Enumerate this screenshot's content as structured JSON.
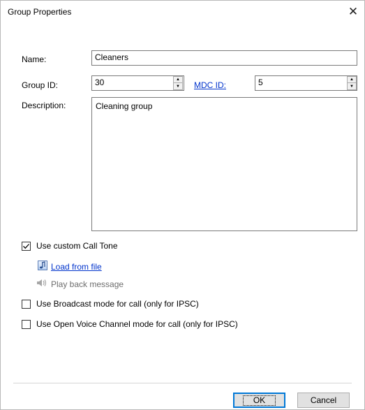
{
  "window": {
    "title": "Group Properties",
    "close_glyph": "✕"
  },
  "form": {
    "name_label": "Name:",
    "name_value": "Cleaners",
    "group_id_label": "Group ID:",
    "group_id_value": "30",
    "mdc_id_label": "MDC ID:",
    "mdc_id_value": "5",
    "description_label": "Description:",
    "description_value": "Cleaning group"
  },
  "options": {
    "custom_call_tone": {
      "label": "Use custom Call Tone",
      "checked": true
    },
    "load_from_file": "Load from file",
    "play_back_message": "Play back message",
    "broadcast_mode": {
      "label": "Use Broadcast mode for call (only for IPSC)",
      "checked": false
    },
    "open_voice_channel": {
      "label": "Use Open Voice Channel mode for call (only for IPSC)",
      "checked": false
    }
  },
  "buttons": {
    "ok": "OK",
    "cancel": "Cancel"
  },
  "icons": {
    "close": "close-icon",
    "spin_up": "spin-up-icon",
    "spin_down": "spin-down-icon",
    "check": "check-icon",
    "music_note": "music-note-icon",
    "speaker": "speaker-icon"
  },
  "colors": {
    "link": "#0033cc",
    "default_button_border": "#0078d7",
    "dialog_border": "#b9b9b9"
  }
}
